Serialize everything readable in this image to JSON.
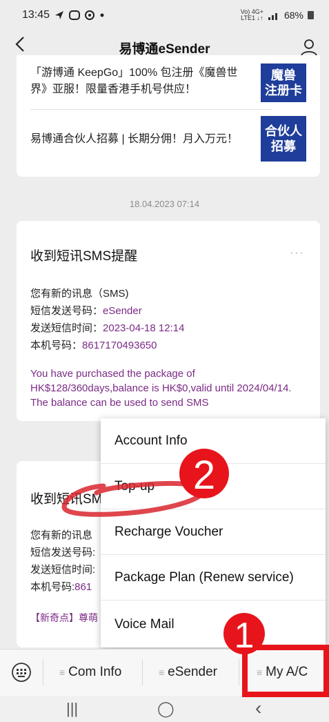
{
  "status_bar": {
    "time": "13:45",
    "signal_top": "Vo) 4G+",
    "signal_bottom": "LTE1 ↓↑",
    "battery": "68%"
  },
  "header": {
    "title": "易博通eSender"
  },
  "news": [
    {
      "text": "「游博通 KeepGo」100% 包注册《魔兽世界》亚服！限量香港手机号供应！",
      "thumb": "魔兽\n注册卡"
    },
    {
      "text": "易博通合伙人招募 | 长期分佣！月入万元！",
      "thumb": "合伙人\n招募"
    }
  ],
  "timestamp": "18.04.2023 07:14",
  "message1": {
    "title": "收到短讯SMS提醒",
    "more": "···",
    "line1": "您有新的讯息（SMS)",
    "sender_label": "短信发送号码：",
    "sender_value": "eSender",
    "time_label": "发送短信时间：",
    "time_value": "2023-04-18 12:14",
    "number_label": "本机号码：",
    "number_value": "8617170493650",
    "body": "You have purchased the package of HK$128/360days,balance is HK$0,valid until 2024/04/14. The balance can be used to send SMS"
  },
  "message2": {
    "title": "收到短讯SM",
    "line1": "您有新的讯息",
    "sender_label": "短信发送号码:",
    "time_label": "发送短信时间:",
    "number_label": "本机号码:",
    "number_value": "861",
    "promo": "【新奇点】尊萌"
  },
  "popup_menu": {
    "items": [
      "Account Info",
      "Top-up",
      "Recharge Voucher",
      "Package Plan (Renew service)",
      "Voice Mail"
    ]
  },
  "bottom_tabs": {
    "items": [
      "Com Info",
      "eSender",
      "My A/C"
    ]
  },
  "annotations": {
    "step1": "1",
    "step2": "2",
    "color": "#e8141b"
  },
  "nav": {
    "recents": "|||",
    "home": "◯",
    "back": "‹"
  }
}
